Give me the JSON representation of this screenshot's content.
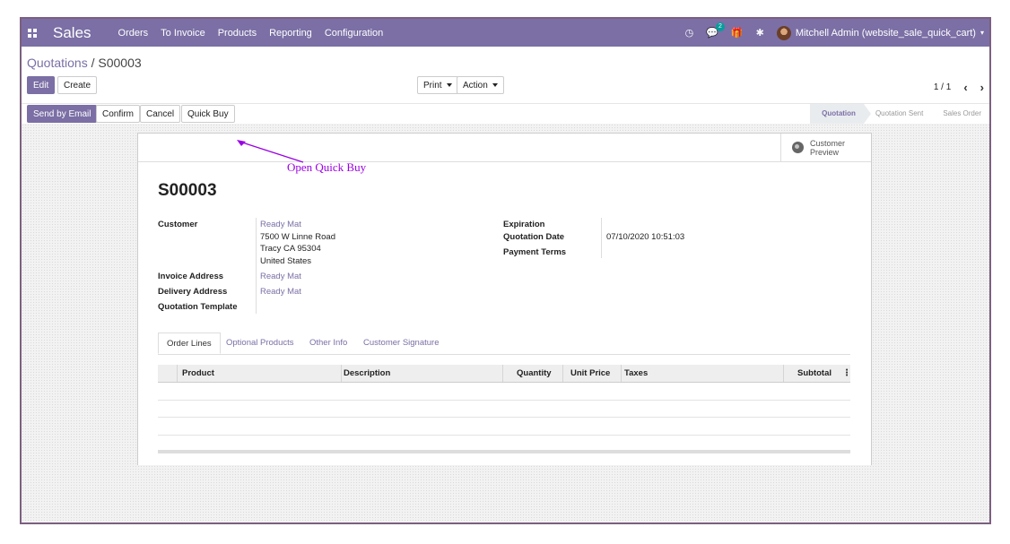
{
  "navbar": {
    "brand": "Sales",
    "menu": [
      "Orders",
      "To Invoice",
      "Products",
      "Reporting",
      "Configuration"
    ],
    "chat_badge": "2",
    "user": "Mitchell Admin (website_sale_quick_cart)"
  },
  "breadcrumb": {
    "parent": "Quotations",
    "separator": "/",
    "current": "S00003"
  },
  "buttons": {
    "edit": "Edit",
    "create": "Create",
    "print": "Print",
    "action": "Action",
    "send_email": "Send by Email",
    "confirm": "Confirm",
    "cancel": "Cancel",
    "quick_buy": "Quick Buy"
  },
  "pager": {
    "value": "1 / 1"
  },
  "stages": [
    "Quotation",
    "Quotation Sent",
    "Sales Order"
  ],
  "active_stage": "Quotation",
  "preview": {
    "line1": "Customer",
    "line2": "Preview"
  },
  "order": {
    "name": "S00003",
    "customer_label": "Customer",
    "customer_name": "Ready Mat",
    "address_line1": "7500 W Linne Road",
    "address_line2": "Tracy CA 95304",
    "address_line3": "United States",
    "invoice_label": "Invoice Address",
    "invoice_value": "Ready Mat",
    "delivery_label": "Delivery Address",
    "delivery_value": "Ready Mat",
    "template_label": "Quotation Template",
    "expiration_label": "Expiration",
    "quotation_date_label": "Quotation Date",
    "quotation_date_value": "07/10/2020 10:51:03",
    "payment_terms_label": "Payment Terms"
  },
  "tabs": [
    "Order Lines",
    "Optional Products",
    "Other Info",
    "Customer Signature"
  ],
  "table": {
    "columns": [
      "Product",
      "Description",
      "Quantity",
      "Unit Price",
      "Taxes",
      "Subtotal"
    ]
  },
  "annotation": "Open Quick Buy",
  "colors": {
    "brand": "#7b6fa5",
    "annotation": "#9a00e3",
    "frame": "#7c5f80"
  }
}
